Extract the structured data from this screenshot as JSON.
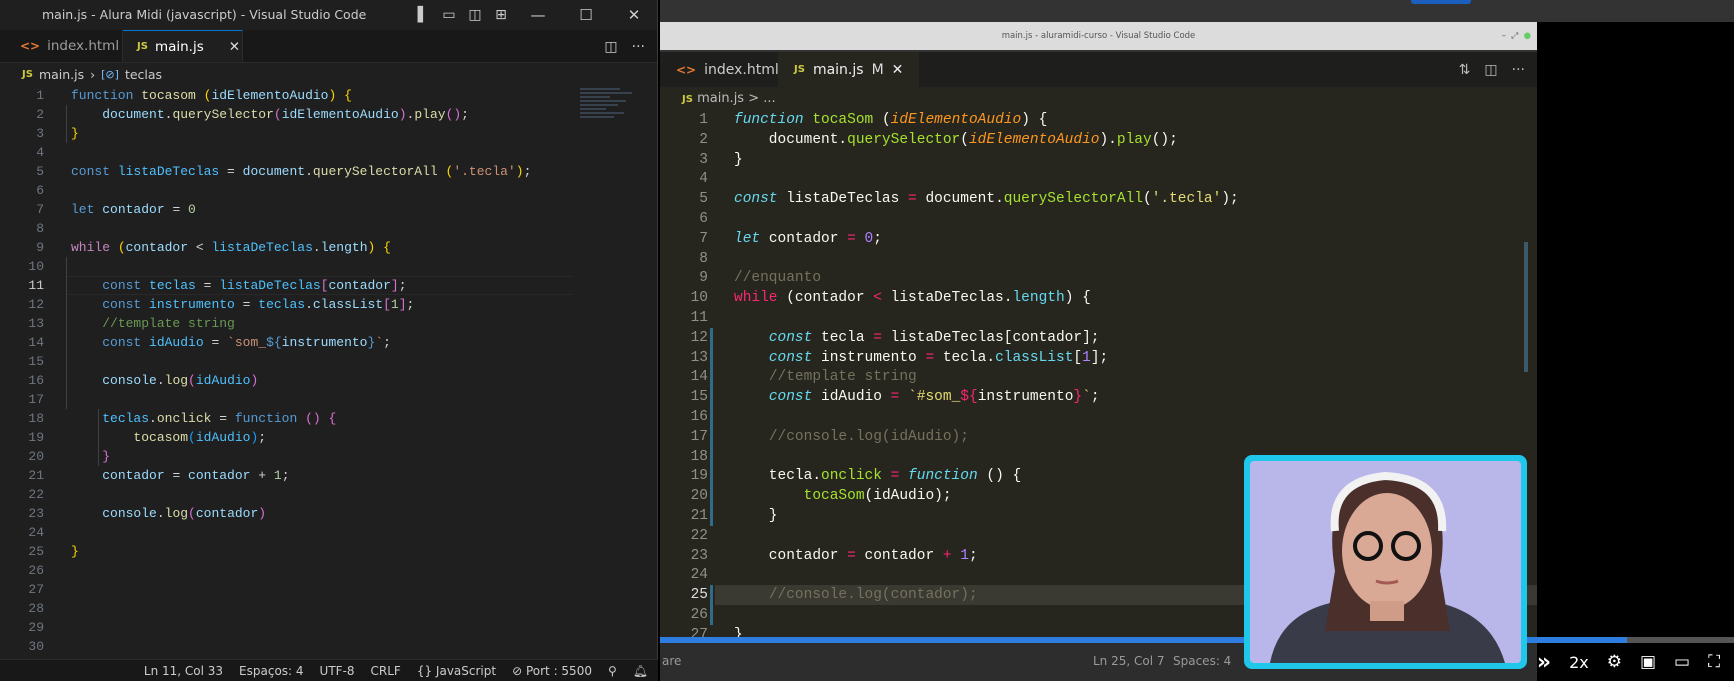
{
  "left_window": {
    "title": "main.js - Alura Midi (javascript) - Visual Studio Code",
    "tabs": [
      {
        "label": "index.html",
        "icon": "html-icon"
      },
      {
        "label": "main.js",
        "icon": "js-icon",
        "active": true
      }
    ],
    "breadcrumb": {
      "file": "main.js",
      "symbol": "teclas"
    },
    "current_line": 11,
    "lines": [
      [
        [
          "kw",
          "function "
        ],
        [
          "fn",
          "tocasom "
        ],
        [
          "b1",
          "("
        ],
        [
          "vr",
          "idElementoAudio"
        ],
        [
          "b1",
          ")"
        ],
        [
          "pl",
          " "
        ],
        [
          "b1",
          "{"
        ]
      ],
      [
        [
          "pl",
          "    "
        ],
        [
          "vr",
          "document"
        ],
        [
          "pl",
          "."
        ],
        [
          "fn",
          "querySelector"
        ],
        [
          "b2",
          "("
        ],
        [
          "vr",
          "idElementoAudio"
        ],
        [
          "b2",
          ")"
        ],
        [
          "pl",
          "."
        ],
        [
          "fn",
          "play"
        ],
        [
          "b2",
          "()"
        ],
        [
          "pl",
          ";"
        ]
      ],
      [
        [
          "b1",
          "}"
        ]
      ],
      [],
      [
        [
          "kw",
          "const "
        ],
        [
          "cv",
          "listaDeTeclas"
        ],
        [
          "pl",
          " = "
        ],
        [
          "vr",
          "document"
        ],
        [
          "pl",
          "."
        ],
        [
          "fn",
          "querySelectorAll"
        ],
        [
          "pl",
          " "
        ],
        [
          "b1",
          "("
        ],
        [
          "st",
          "'.tecla'"
        ],
        [
          "b1",
          ")"
        ],
        [
          "pl",
          ";"
        ]
      ],
      [],
      [
        [
          "kw",
          "let "
        ],
        [
          "vr",
          "contador"
        ],
        [
          "pl",
          " = "
        ],
        [
          "nm",
          "0"
        ]
      ],
      [],
      [
        [
          "ctl",
          "while "
        ],
        [
          "b1",
          "("
        ],
        [
          "vr",
          "contador"
        ],
        [
          "pl",
          " < "
        ],
        [
          "cv",
          "listaDeTeclas"
        ],
        [
          "pl",
          "."
        ],
        [
          "vr",
          "length"
        ],
        [
          "b1",
          ")"
        ],
        [
          "pl",
          " "
        ],
        [
          "b1",
          "{"
        ]
      ],
      [],
      [
        [
          "pl",
          "    "
        ],
        [
          "kw",
          "const "
        ],
        [
          "cv",
          "teclas"
        ],
        [
          "pl",
          " = "
        ],
        [
          "cv",
          "listaDeTeclas"
        ],
        [
          "b2",
          "["
        ],
        [
          "vr",
          "contador"
        ],
        [
          "b2",
          "]"
        ],
        [
          "pl",
          ";"
        ]
      ],
      [
        [
          "pl",
          "    "
        ],
        [
          "kw",
          "const "
        ],
        [
          "cv",
          "instrumento"
        ],
        [
          "pl",
          " = "
        ],
        [
          "cv",
          "teclas"
        ],
        [
          "pl",
          "."
        ],
        [
          "vr",
          "classList"
        ],
        [
          "b2",
          "["
        ],
        [
          "nm",
          "1"
        ],
        [
          "b2",
          "]"
        ],
        [
          "pl",
          ";"
        ]
      ],
      [
        [
          "pl",
          "    "
        ],
        [
          "cm",
          "//template string"
        ]
      ],
      [
        [
          "pl",
          "    "
        ],
        [
          "kw",
          "const "
        ],
        [
          "cv",
          "idAudio"
        ],
        [
          "pl",
          " = "
        ],
        [
          "st",
          "`som_"
        ],
        [
          "kw",
          "${"
        ],
        [
          "vr",
          "instrumento"
        ],
        [
          "kw",
          "}"
        ],
        [
          "st",
          "`"
        ],
        [
          "pl",
          ";"
        ]
      ],
      [],
      [
        [
          "pl",
          "    "
        ],
        [
          "vr",
          "console"
        ],
        [
          "pl",
          "."
        ],
        [
          "fn",
          "log"
        ],
        [
          "b2",
          "("
        ],
        [
          "cv",
          "idAudio"
        ],
        [
          "b2",
          ")"
        ]
      ],
      [],
      [
        [
          "pl",
          "    "
        ],
        [
          "cv",
          "teclas"
        ],
        [
          "pl",
          "."
        ],
        [
          "fn",
          "onclick"
        ],
        [
          "pl",
          " = "
        ],
        [
          "kw",
          "function "
        ],
        [
          "b2",
          "()"
        ],
        [
          "pl",
          " "
        ],
        [
          "b2",
          "{"
        ]
      ],
      [
        [
          "pl",
          "        "
        ],
        [
          "fn",
          "tocasom"
        ],
        [
          "b3",
          "("
        ],
        [
          "cv",
          "idAudio"
        ],
        [
          "b3",
          ")"
        ],
        [
          "pl",
          ";"
        ]
      ],
      [
        [
          "pl",
          "    "
        ],
        [
          "b2",
          "}"
        ]
      ],
      [
        [
          "pl",
          "    "
        ],
        [
          "vr",
          "contador"
        ],
        [
          "pl",
          " = "
        ],
        [
          "vr",
          "contador"
        ],
        [
          "pl",
          " + "
        ],
        [
          "nm",
          "1"
        ],
        [
          "pl",
          ";"
        ]
      ],
      [],
      [
        [
          "pl",
          "    "
        ],
        [
          "vr",
          "console"
        ],
        [
          "pl",
          "."
        ],
        [
          "fn",
          "log"
        ],
        [
          "b2",
          "("
        ],
        [
          "vr",
          "contador"
        ],
        [
          "b2",
          ")"
        ]
      ],
      [],
      [
        [
          "b1",
          "}"
        ]
      ],
      [],
      [],
      [],
      [],
      []
    ],
    "status": [
      "Ln 11, Col 33",
      "Espaços: 4",
      "UTF-8",
      "CRLF",
      "{} JavaScript",
      "⊘ Port : 5500"
    ]
  },
  "video": {
    "inner_title": "main.js - aluramidi-curso - Visual Studio Code",
    "tabs": [
      {
        "label": "index.html",
        "icon": "html-icon"
      },
      {
        "label": "main.js",
        "icon": "js-icon",
        "modified": "M",
        "active": true
      }
    ],
    "breadcrumb": "main.js > ...",
    "current_line": 25,
    "lines": [
      [
        [
          "mk",
          "function "
        ],
        [
          "mf",
          "tocaSom "
        ],
        [
          "mw",
          "("
        ],
        [
          "mp",
          "idElementoAudio"
        ],
        [
          "mw",
          ") {"
        ]
      ],
      [
        [
          "mw",
          "    document."
        ],
        [
          "mf",
          "querySelector"
        ],
        [
          "mw",
          "("
        ],
        [
          "mp",
          "idElementoAudio"
        ],
        [
          "mw",
          ")."
        ],
        [
          "mf",
          "play"
        ],
        [
          "mw",
          "();"
        ]
      ],
      [
        [
          "mw",
          "}"
        ]
      ],
      [],
      [
        [
          "mk",
          "const "
        ],
        [
          "mw",
          "listaDeTeclas "
        ],
        [
          "mo",
          "="
        ],
        [
          "mw",
          " document."
        ],
        [
          "mf",
          "querySelectorAll"
        ],
        [
          "mw",
          "("
        ],
        [
          "ms",
          "'.tecla'"
        ],
        [
          "mw",
          ");"
        ]
      ],
      [],
      [
        [
          "mk",
          "let "
        ],
        [
          "mw",
          "contador "
        ],
        [
          "mo",
          "="
        ],
        [
          "mw",
          " "
        ],
        [
          "mn",
          "0"
        ],
        [
          "mw",
          ";"
        ]
      ],
      [],
      [
        [
          "mc",
          "//enquanto"
        ]
      ],
      [
        [
          "mo",
          "while "
        ],
        [
          "mw",
          "(contador "
        ],
        [
          "mo",
          "<"
        ],
        [
          "mw",
          " listaDeTeclas."
        ],
        [
          "mprop",
          "length"
        ],
        [
          "mw",
          ") {"
        ]
      ],
      [],
      [
        [
          "mw",
          "    "
        ],
        [
          "mk",
          "const "
        ],
        [
          "mw",
          "tecla "
        ],
        [
          "mo",
          "="
        ],
        [
          "mw",
          " listaDeTeclas[contador];"
        ]
      ],
      [
        [
          "mw",
          "    "
        ],
        [
          "mk",
          "const "
        ],
        [
          "mw",
          "instrumento "
        ],
        [
          "mo",
          "="
        ],
        [
          "mw",
          " tecla."
        ],
        [
          "mprop",
          "classList"
        ],
        [
          "mw",
          "["
        ],
        [
          "mn",
          "1"
        ],
        [
          "mw",
          "];"
        ]
      ],
      [
        [
          "mw",
          "    "
        ],
        [
          "mc",
          "//template string"
        ]
      ],
      [
        [
          "mw",
          "    "
        ],
        [
          "mk",
          "const "
        ],
        [
          "mw",
          "idAudio "
        ],
        [
          "mo",
          "="
        ],
        [
          "mw",
          " "
        ],
        [
          "ms",
          "`#som_"
        ],
        [
          "mo",
          "${"
        ],
        [
          "mw",
          "instrumento"
        ],
        [
          "mo",
          "}"
        ],
        [
          "ms",
          "`"
        ],
        [
          "mw",
          ";"
        ]
      ],
      [],
      [
        [
          "mw",
          "    "
        ],
        [
          "mc",
          "//console.log(idAudio);"
        ]
      ],
      [],
      [
        [
          "mw",
          "    tecla."
        ],
        [
          "mf",
          "onclick"
        ],
        [
          "mw",
          " "
        ],
        [
          "mo",
          "="
        ],
        [
          "mw",
          " "
        ],
        [
          "mk",
          "function"
        ],
        [
          "mw",
          " () {"
        ]
      ],
      [
        [
          "mw",
          "        "
        ],
        [
          "mf",
          "tocaSom"
        ],
        [
          "mw",
          "(idAudio);"
        ]
      ],
      [
        [
          "mw",
          "    }"
        ]
      ],
      [],
      [
        [
          "mw",
          "    contador "
        ],
        [
          "mo",
          "="
        ],
        [
          "mw",
          " contador "
        ],
        [
          "mo",
          "+"
        ],
        [
          "mw",
          " "
        ],
        [
          "mn",
          "1"
        ],
        [
          "mw",
          ";"
        ]
      ],
      [],
      [
        [
          "mw",
          "    "
        ],
        [
          "mc",
          "//console.log(contador);"
        ]
      ],
      [],
      [
        [
          "mw",
          "}"
        ]
      ]
    ],
    "status": {
      "left": "are",
      "position": "Ln 25, Col 7",
      "spaces": "Spaces: 4"
    },
    "progress_percent": 90,
    "playback_speed": "2x",
    "accent": "#2e7de0"
  }
}
